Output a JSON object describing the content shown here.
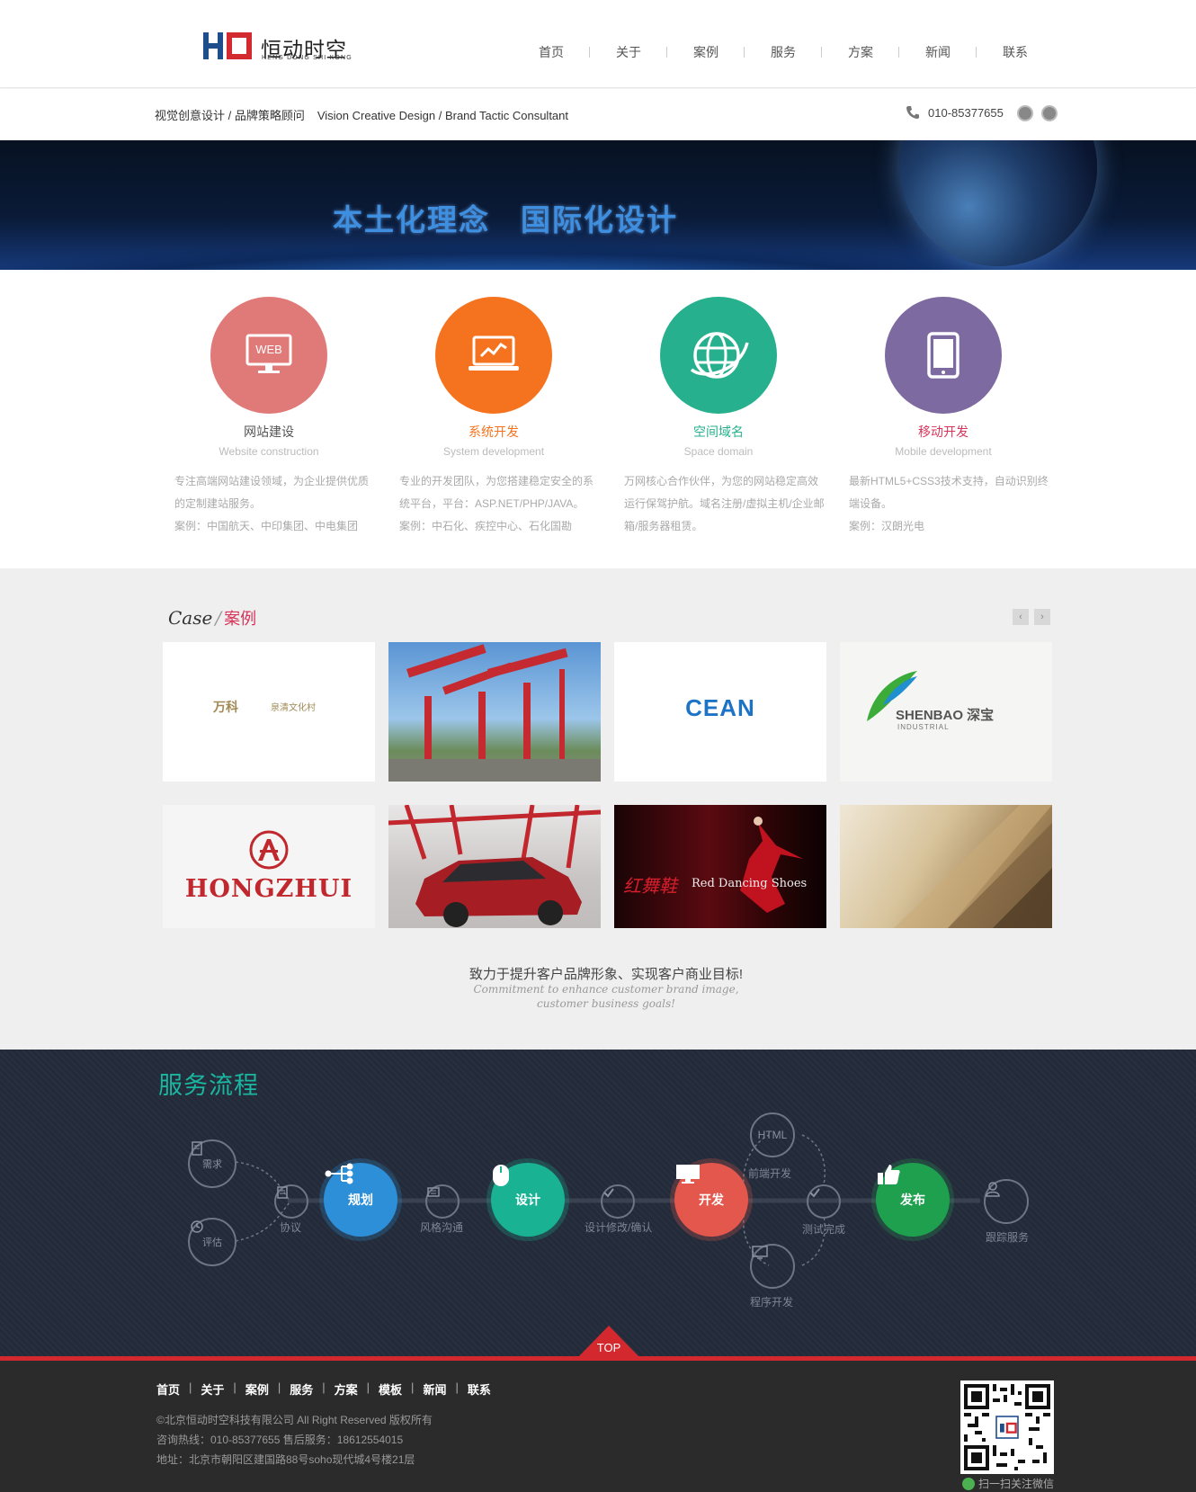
{
  "header": {
    "logo_cn": "恒动时空",
    "logo_en": "HENG DONG SHI KONG",
    "nav": [
      "首页",
      "关于",
      "案例",
      "服务",
      "方案",
      "新闻",
      "联系"
    ]
  },
  "subbar": {
    "tagline_cn": "视觉创意设计 / 品牌策略顾问",
    "tagline_en": "Vision Creative Design / Brand Tactic Consultant",
    "phone": "010-85377655"
  },
  "banner": {
    "title_left": "本土化理念",
    "title_right": "国际化设计"
  },
  "services": [
    {
      "title": "网站建设",
      "subtitle": "Website construction",
      "icon_label": "WEB",
      "desc1": "专注高端网站建设领域，为企业提供优质的定制建站服务。",
      "case": "案例：中国航天、中印集团、中电集团",
      "color": "#e07a78",
      "title_color": "#555555"
    },
    {
      "title": "系统开发",
      "subtitle": "System development",
      "icon_label": "",
      "desc1": "专业的开发团队，为您搭建稳定安全的系统平台，平台：ASP.NET/PHP/JAVA。",
      "case": "案例：中石化、疾控中心、石化国勘",
      "color": "#f5731f",
      "title_color": "#f5731f"
    },
    {
      "title": "空间域名",
      "subtitle": "Space domain",
      "icon_label": "",
      "desc1": "万网核心合作伙伴，为您的网站稳定高效运行保驾护航。域名注册/虚拟主机/企业邮箱/服务器租赁。",
      "case": "",
      "color": "#26b08d",
      "title_color": "#26b08d"
    },
    {
      "title": "移动开发",
      "subtitle": "Mobile development",
      "icon_label": "",
      "desc1": "最新HTML5+CSS3技术支持，自动识别终端设备。",
      "case": "案例：汉朗光电",
      "color": "#7d6aa0",
      "title_color": "#d6345a"
    }
  ],
  "case_section": {
    "title_en": "Case",
    "title_cn": "案例",
    "cards": [
      "万科",
      "泉清文化村",
      "CEAN",
      "SHENBAO 深宝",
      "INDUSTRIAL",
      "HONGZHUI",
      "Red Dancing Shoes",
      "红舞鞋"
    ],
    "slogan_cn": "致力于提升客户品牌形象、实现客户商业目标!",
    "slogan_en_1": "Commitment to enhance customer brand image,",
    "slogan_en_2": "customer business goals!"
  },
  "process": {
    "title": "服务流程",
    "nodes": {
      "xuqiu": "需求",
      "pinggu": "评估",
      "xieyi": "协议",
      "guihua": "规划",
      "fengge": "风格沟通",
      "sheji": "设计",
      "xiugai": "设计修改/确认",
      "html": "HTML",
      "qianduan": "前端开发",
      "kaifa": "开发",
      "chengxu": "程序开发",
      "ceshi": "测试完成",
      "fabu": "发布",
      "genzong": "跟踪服务"
    },
    "colors": {
      "guihua": "#2d8fd8",
      "sheji": "#19b394",
      "kaifa": "#e4574c",
      "fabu": "#1ea04f"
    }
  },
  "top_button": "TOP",
  "footer": {
    "nav": [
      "首页",
      "关于",
      "案例",
      "服务",
      "方案",
      "模板",
      "新闻",
      "联系"
    ],
    "copyright": "©北京恒动时空科技有限公司 All Right Reserved 版权所有",
    "hotline": "咨询热线：010-85377655 售后服务：18612554015",
    "address": "地址：北京市朝阳区建国路88号soho现代城4号楼21层",
    "qr_label": "扫一扫关注微信"
  }
}
